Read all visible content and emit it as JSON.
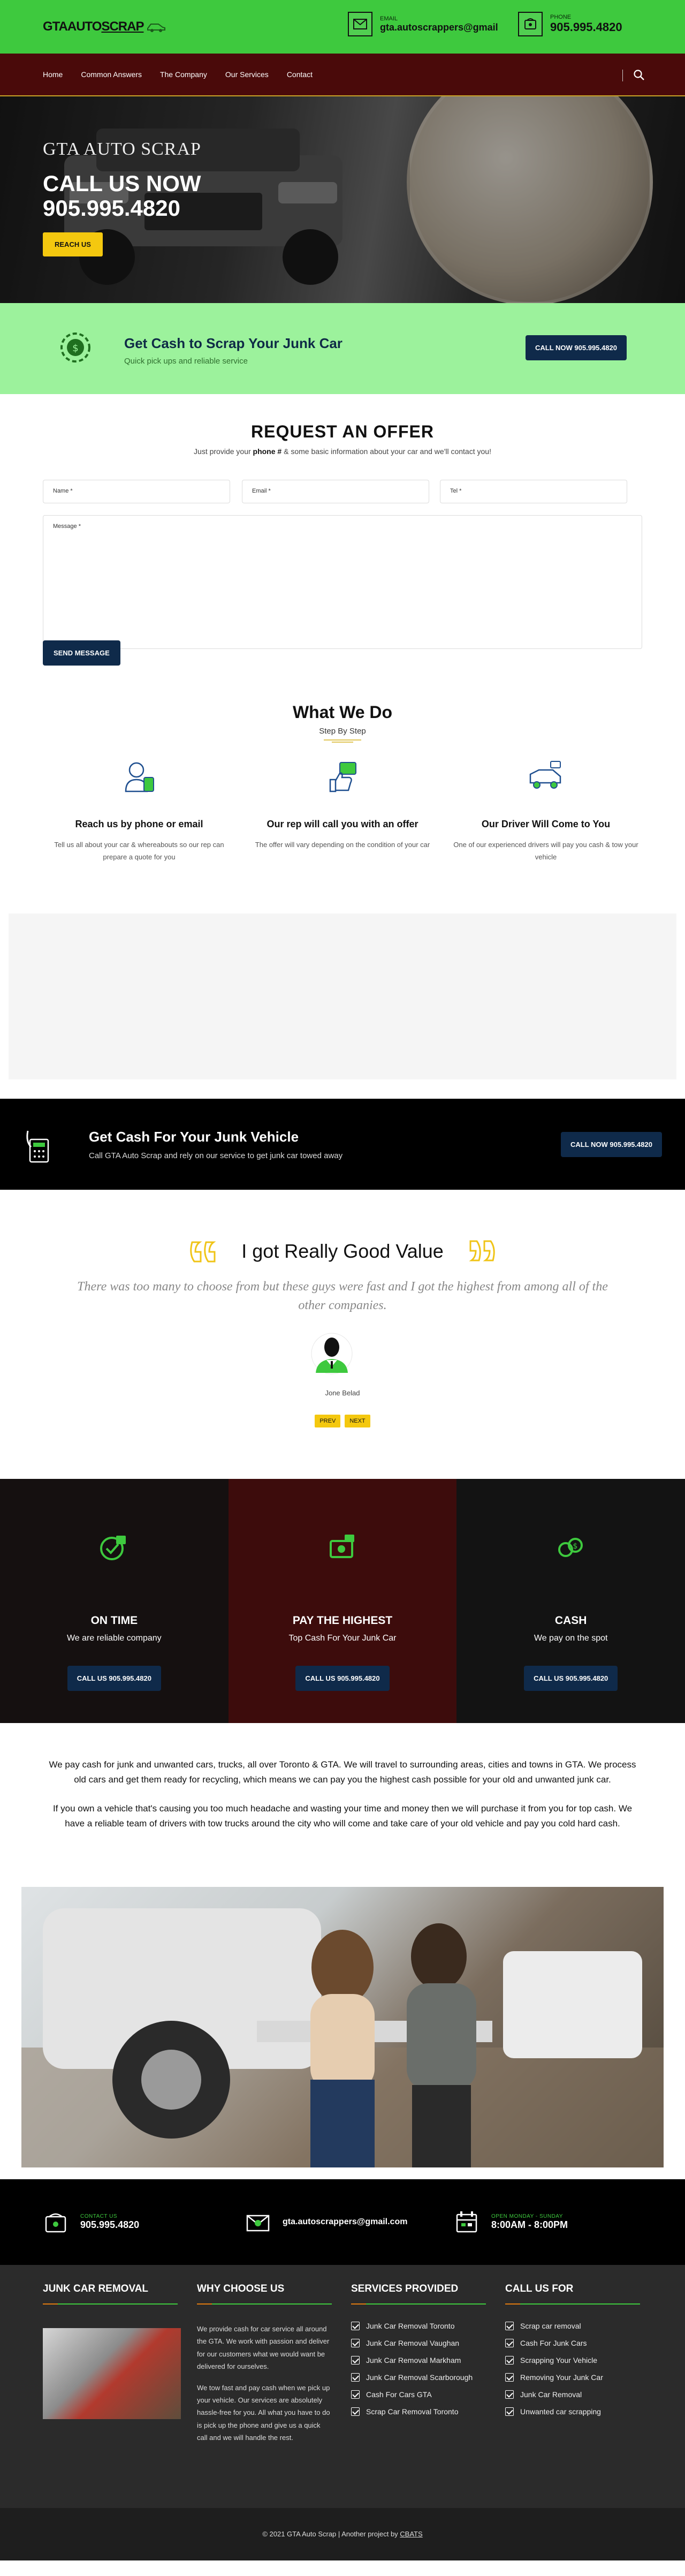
{
  "header": {
    "logo_text_a": "GTAAUTO",
    "logo_text_b": "SCRAP",
    "email_label": "EMAIL",
    "email": "gta.autoscrappers@gmail",
    "phone_label": "PHONE",
    "phone": "905.995.4820"
  },
  "nav": {
    "items": [
      "Home",
      "Common Answers",
      "The Company",
      "Our Services",
      "Contact"
    ]
  },
  "hero": {
    "brand": "GTA AUTO SCRAP",
    "call": "CALL US NOW",
    "number": "905.995.4820",
    "button": "REACH US"
  },
  "cash_banner": {
    "heading": "Get Cash to Scrap Your Junk Car",
    "sub": "Quick pick ups and reliable service",
    "button": "CALL NOW 905.995.4820"
  },
  "request": {
    "title": "REQUEST AN OFFER",
    "sub_before": "Just provide your ",
    "sub_bold": "phone #",
    "sub_after": " & some basic information about your car and we'll contact you!",
    "name_ph": "Name *",
    "email_ph": "Email *",
    "tel_ph": "Tel *",
    "message_ph": "Message *",
    "send": "SEND MESSAGE"
  },
  "what_we_do": {
    "title": "What We Do",
    "subtitle": "Step By Step",
    "steps": [
      {
        "title": "Reach us by phone or email",
        "text": "Tell us all about your car & whereabouts so our rep can prepare a quote for you"
      },
      {
        "title": "Our rep will call you with an offer",
        "text": "The offer will vary depending on the condition of your car"
      },
      {
        "title": "Our Driver Will Come to You",
        "text": "One of our experienced drivers will pay you cash & tow your vehicle"
      }
    ]
  },
  "black_banner": {
    "heading": "Get Cash For Your Junk Vehicle",
    "sub": "Call GTA Auto Scrap and rely on our service to get junk car towed away",
    "button": "CALL NOW 905.995.4820"
  },
  "testimonial": {
    "title": "I got Really Good Value",
    "quote": "There was too many to choose from but these guys were fast and I got the highest from among all of the other companies.",
    "name": "Jone Belad",
    "prev": "PREV",
    "next": "NEXT"
  },
  "features": [
    {
      "title": "ON TIME",
      "text": "We are reliable company",
      "button": "CALL US 905.995.4820"
    },
    {
      "title": "PAY THE HIGHEST",
      "text": "Top Cash For Your Junk Car",
      "button": "CALL US 905.995.4820"
    },
    {
      "title": "CASH",
      "text": "We pay on the spot",
      "button": "CALL US 905.995.4820"
    }
  ],
  "about": {
    "p1": "We pay cash for junk and unwanted cars, trucks, all over Toronto & GTA. We will travel to surrounding areas, cities and towns in GTA. We process old cars and get them ready for recycling, which means we can pay you the highest cash possible for your old and unwanted junk car.",
    "p2": "If you own a vehicle that's causing you too much headache and wasting your time and money then we will purchase it from you for top cash. We have a reliable team of drivers with tow trucks around the city who will come and take care of your old vehicle and pay you cold hard cash."
  },
  "footer_bar": {
    "contact_label": "CONTACT US",
    "contact": "905.995.4820",
    "email": "gta.autoscrappers@gmail.com",
    "hours_label": "OPEN MONDAY - SUNDAY",
    "hours": "8:00AM - 8:00PM"
  },
  "footer": {
    "col1_title": "JUNK CAR REMOVAL",
    "col2_title": "WHY CHOOSE US",
    "col2_p1": "We provide cash for car service all around the GTA. We work with passion and deliver for our customers what we would want be delivered for ourselves.",
    "col2_p2": "We tow fast and pay cash when we pick up your vehicle. Our services are absolutely hassle-free for you. All what you have to do is pick up the phone and give us a quick call and we will handle the rest.",
    "col3_title": "SERVICES PROVIDED",
    "col3_items": [
      "Junk Car Removal Toronto",
      "Junk Car Removal Vaughan",
      "Junk Car Removal Markham",
      "Junk Car Removal Scarborough",
      "Cash For Cars GTA",
      "Scrap Car Removal Toronto"
    ],
    "col4_title": "CALL US FOR",
    "col4_items": [
      "Scrap car removal",
      "Cash For Junk Cars",
      "Scrapping Your Vehicle",
      "Removing Your Junk Car",
      "Junk Car Removal",
      "Unwanted car scrapping"
    ]
  },
  "copyright": {
    "text": "© 2021 GTA Auto Scrap | Another project by ",
    "link": "CBATS"
  },
  "colors": {
    "green": "#3ec93e",
    "maroon": "#4a0a0a",
    "navy": "#0f2a4a",
    "yellow": "#f4c80f",
    "light_green": "#9cf29c"
  }
}
